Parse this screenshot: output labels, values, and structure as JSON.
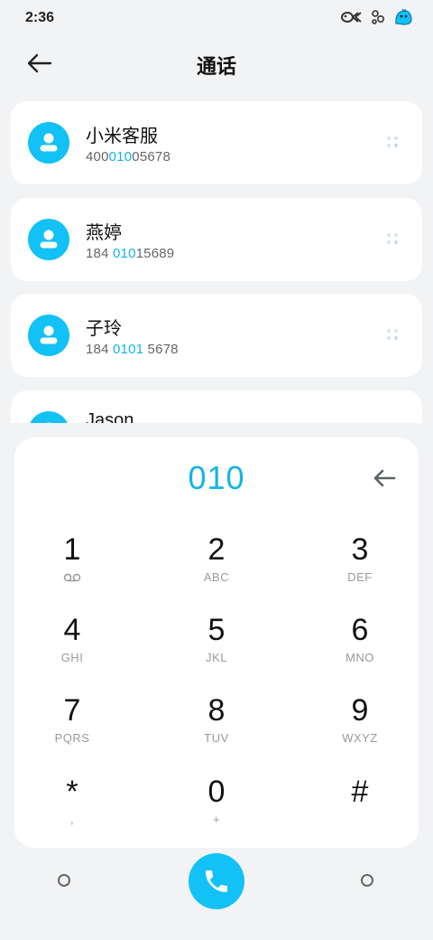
{
  "status_bar": {
    "time": "2:36"
  },
  "header": {
    "title": "通话"
  },
  "contacts": [
    {
      "name": "小米客服",
      "number_parts": [
        "400",
        "010",
        "05678"
      ]
    },
    {
      "name": "燕婷",
      "number_parts": [
        "184 ",
        "010",
        "15689"
      ]
    },
    {
      "name": "子玲",
      "number_parts": [
        "184 ",
        "0101",
        " 5678"
      ]
    },
    {
      "name": "Jason",
      "number_parts": [
        "",
        "",
        ""
      ]
    }
  ],
  "dialpad": {
    "input": "010",
    "keys": [
      {
        "digit": "1",
        "letters": ""
      },
      {
        "digit": "2",
        "letters": "ABC"
      },
      {
        "digit": "3",
        "letters": "DEF"
      },
      {
        "digit": "4",
        "letters": "GHI"
      },
      {
        "digit": "5",
        "letters": "JKL"
      },
      {
        "digit": "6",
        "letters": "MNO"
      },
      {
        "digit": "7",
        "letters": "PQRS"
      },
      {
        "digit": "8",
        "letters": "TUV"
      },
      {
        "digit": "9",
        "letters": "WXYZ"
      },
      {
        "digit": "*",
        "letters": ","
      },
      {
        "digit": "0",
        "letters": "+"
      },
      {
        "digit": "#",
        "letters": ""
      }
    ]
  },
  "colors": {
    "accent": "#12c1f5",
    "highlight": "#12b4e8",
    "background": "#f2f3f5"
  },
  "icons": {
    "back": "arrow-left-icon",
    "delete": "backspace-arrow-icon",
    "call": "phone-icon",
    "more": "dots-icon",
    "avatar": "person-icon",
    "voicemail": "voicemail-icon"
  }
}
